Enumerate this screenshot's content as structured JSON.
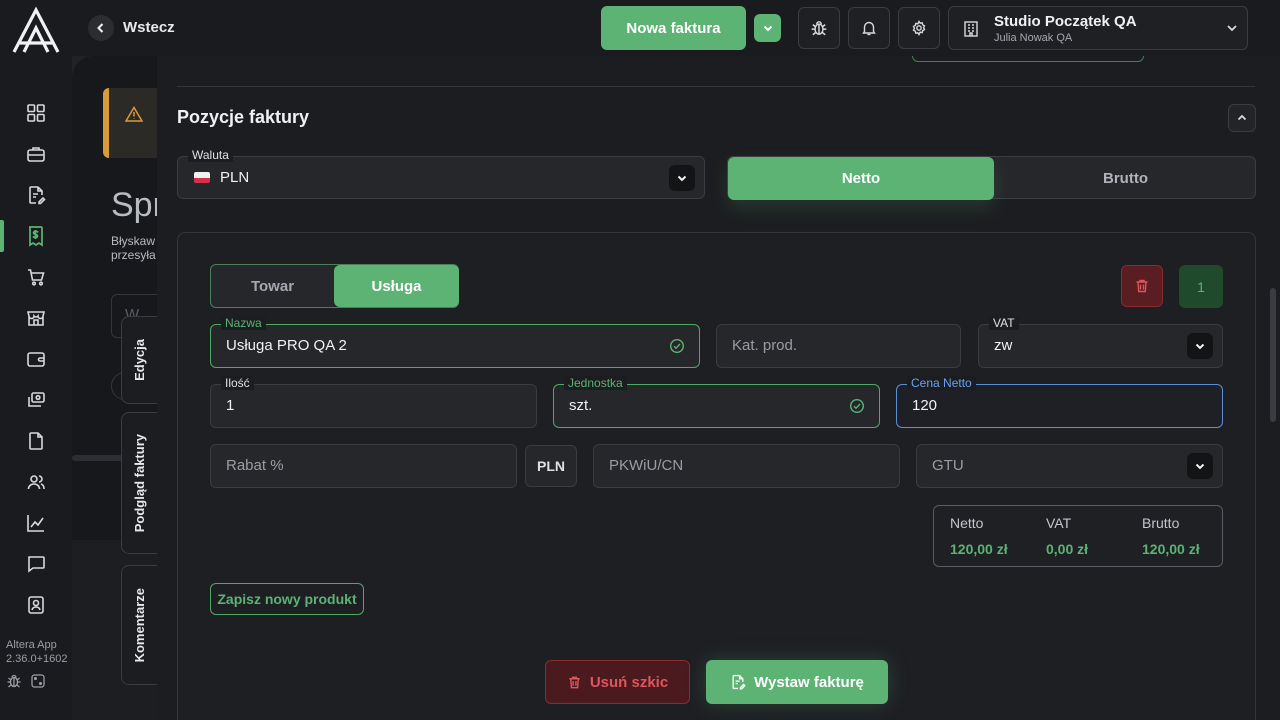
{
  "app": {
    "name": "Altera App",
    "version": "2.36.0+1602"
  },
  "header": {
    "back_label": "Wstecz",
    "new_invoice_label": "Nowa faktura",
    "company_name": "Studio Początek QA",
    "company_user": "Julia Nowak QA"
  },
  "sidebar": {
    "items": [
      {
        "icon": "dashboard-icon"
      },
      {
        "icon": "briefcase-icon"
      },
      {
        "icon": "document-edit-icon"
      },
      {
        "icon": "invoice-dollar-icon",
        "active": true
      },
      {
        "icon": "cart-icon"
      },
      {
        "icon": "store-icon"
      },
      {
        "icon": "wallet-icon"
      },
      {
        "icon": "payments-icon"
      },
      {
        "icon": "file-icon"
      },
      {
        "icon": "users-icon"
      },
      {
        "icon": "chart-icon"
      },
      {
        "icon": "chat-icon"
      },
      {
        "icon": "contact-icon"
      }
    ]
  },
  "background_page": {
    "title_fragment": "Spr",
    "text_line1": "Błyskaw",
    "text_line2": "przesyła",
    "input_fragment": "W"
  },
  "side_tabs": {
    "edit": "Edycja",
    "preview": "Podgląd faktury",
    "comments": "Komentarze"
  },
  "section": {
    "title": "Pozycje faktury",
    "currency_label": "Waluta",
    "currency_value": "PLN",
    "mode_options": [
      "Netto",
      "Brutto"
    ],
    "mode_selected": "Netto"
  },
  "item": {
    "type_options": [
      "Towar",
      "Usługa"
    ],
    "type_selected": "Usługa",
    "number": "1",
    "name_label": "Nazwa",
    "name_value": "Usługa PRO QA 2",
    "category_placeholder": "Kat. prod.",
    "vat_label": "VAT",
    "vat_value": "zw",
    "quantity_label": "Ilość",
    "quantity_value": "1",
    "unit_label": "Jednostka",
    "unit_value": "szt.",
    "price_label": "Cena Netto",
    "price_value": "120",
    "discount_placeholder": "Rabat %",
    "discount_currency": "PLN",
    "pkwiu_placeholder": "PKWiU/CN",
    "gtu_placeholder": "GTU",
    "summary": {
      "net_label": "Netto",
      "vat_label": "VAT",
      "gross_label": "Brutto",
      "net_value": "120,00 zł",
      "vat_value": "0,00 zł",
      "gross_value": "120,00 zł"
    },
    "save_product_label": "Zapisz nowy produkt"
  },
  "footer": {
    "delete_draft_label": "Usuń szkic",
    "issue_invoice_label": "Wystaw fakturę"
  },
  "colors": {
    "accent": "#5cb374",
    "danger": "#e0545e",
    "warning": "#d99a3c",
    "focus": "#5b8fd6"
  }
}
